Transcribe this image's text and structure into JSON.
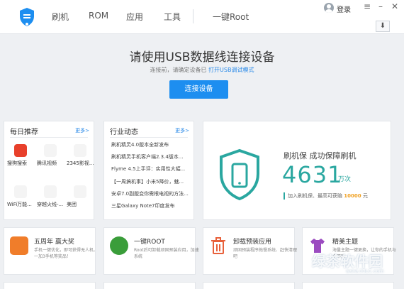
{
  "nav": [
    "刷机",
    "ROM",
    "应用",
    "工具",
    "一键Root"
  ],
  "account": {
    "login_label": "登录"
  },
  "window_buttons": {
    "menu": "≡",
    "minimize": "–",
    "close": "✕",
    "download": "⬇"
  },
  "hero": {
    "title": "请使用USB数据线连接设备",
    "subtitle_prefix": "连接前，请确定设备已",
    "subtitle_link": "打开USB调试模式",
    "connect_button": "连接设备"
  },
  "daily": {
    "title": "每日推荐",
    "more": "更多>",
    "apps": [
      {
        "label": "搜狗搜索",
        "icon": "sogou-icon",
        "color": "#e8402b"
      },
      {
        "label": "腾讯视频",
        "icon": "tencent-video-icon",
        "color": "#ffffff"
      },
      {
        "label": "2345影视...",
        "icon": "video-icon",
        "color": "#ffffff"
      },
      {
        "label": "WiFi万能...",
        "icon": "wifi-icon",
        "color": "#ffffff"
      },
      {
        "label": "穿越火线-...",
        "icon": "game-icon",
        "color": "#ffffff"
      },
      {
        "label": "美团",
        "icon": "meituan-icon",
        "color": "#ffffff"
      }
    ]
  },
  "news": {
    "title": "行业动态",
    "more": "更多>",
    "items": [
      "刷机精灵4.0版本全新发布",
      "刷机精灵手机客户端2.3.4版本...",
      "Flyme 4.5上手评：实用性大幅...",
      "【一周搞机事】小米5降价，魅...",
      "安卓7.0副版变你需根电视的方法...",
      "三星Galaxy Note7印度发布"
    ]
  },
  "stats": {
    "title": "刷机保  成功保障刷机",
    "number": "4631",
    "unit": "万次",
    "foot_text": "加入刷机保、最高可获赔",
    "foot_amount": "10000",
    "foot_suffix": "元",
    "accent": "#2aa7a0"
  },
  "features": [
    {
      "title": "五周年 赢大奖",
      "desc": "手机一键优化，即可获得无人机、一加3手机等奖品！",
      "icon": "anniversary-icon",
      "color": "#f07d2a"
    },
    {
      "title": "一键ROOT",
      "desc": "Root后可卸载顽固预装应用，加速系统",
      "icon": "root-icon",
      "color": "#3a9d3a"
    },
    {
      "title": "卸载预装应用",
      "desc": "顽固预装程序拖慢系统、赶快清理吧",
      "icon": "trash-icon",
      "color": "#e8603a"
    },
    {
      "title": "精美主题",
      "desc": "海量主题一键更换，让你的手机与众不同",
      "icon": "shirt-icon",
      "color": "#9b4bc0"
    }
  ],
  "watermark": {
    "text": "绿茶软件园",
    "url": "www.33LC.com"
  }
}
